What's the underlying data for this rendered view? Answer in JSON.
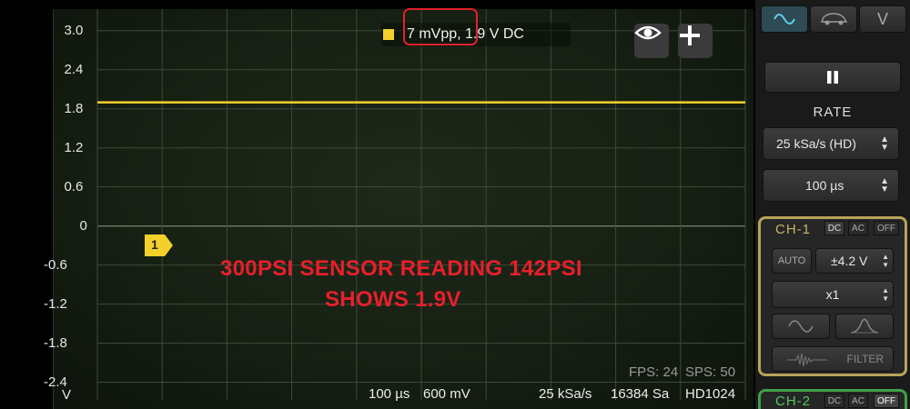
{
  "chart_data": {
    "type": "line",
    "y_tick_labels": [
      "3.0",
      "2.4",
      "1.8",
      "1.2",
      "0.6",
      "0",
      "-0.6",
      "-1.2",
      "-1.8",
      "-2.4"
    ],
    "y_unit": "V",
    "series": [
      {
        "name": "1",
        "values": [
          1.9
        ],
        "color": "#f3d02c"
      }
    ],
    "ylim": [
      -2.7,
      3.5
    ],
    "grid": true
  },
  "legend": {
    "text": "7 mVpp, 1.9 V DC",
    "color": "#f3d02c"
  },
  "timebase": {
    "time_div": "100 µs",
    "volt_div": "600 mV",
    "rate": "25 kSa/s",
    "samples": "16384 Sa",
    "mode": "HD1024"
  },
  "stats": {
    "fps": "FPS: 24",
    "sps": "SPS: 50"
  },
  "annotation": {
    "line1": "300PSI SENSOR READING 142PSI",
    "line2": "SHOWS 1.9V"
  },
  "channel_marker": "1",
  "panel": {
    "rate_label": "RATE",
    "rate_value": "25 kSa/s (HD)",
    "time_value": "100 µs",
    "ch1": {
      "label": "CH-1",
      "dc": "DC",
      "ac": "AC",
      "off": "OFF",
      "auto": "AUTO",
      "range": "±4.2 V",
      "probe": "x1",
      "filter": "FILTER"
    },
    "ch2": {
      "label": "CH-2",
      "dc": "DC",
      "ac": "AC",
      "off": "OFF"
    },
    "tab_v": "V"
  },
  "icons": [
    "sine-wave-icon",
    "car-icon",
    "eye-icon",
    "plus-icon",
    "pause-icon"
  ]
}
